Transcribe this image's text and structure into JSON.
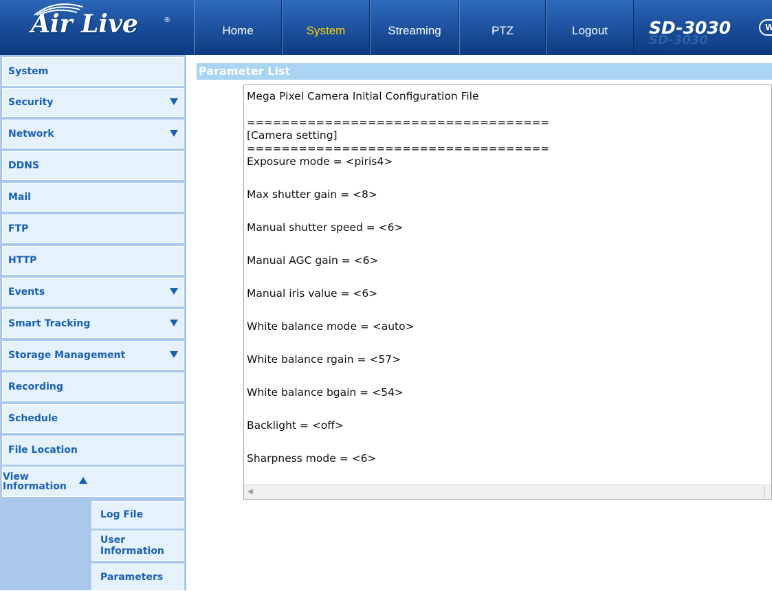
{
  "brand": {
    "logo_text": "Air Live",
    "reg_mark": "®",
    "model": "SD-3030",
    "model_badge": "W"
  },
  "nav": {
    "home": "Home",
    "system": "System",
    "streaming": "Streaming",
    "ptz": "PTZ",
    "logout": "Logout",
    "active": "System",
    "active_color": "#ffd400"
  },
  "sidebar": {
    "items": [
      {
        "label": "System",
        "expandable": false
      },
      {
        "label": "Security",
        "expandable": true
      },
      {
        "label": "Network",
        "expandable": true
      },
      {
        "label": "DDNS",
        "expandable": false
      },
      {
        "label": "Mail",
        "expandable": false
      },
      {
        "label": "FTP",
        "expandable": false
      },
      {
        "label": "HTTP",
        "expandable": false
      },
      {
        "label": "Events",
        "expandable": true
      },
      {
        "label": "Smart Tracking",
        "expandable": true
      },
      {
        "label": "Storage Management",
        "expandable": true
      },
      {
        "label": "Recording",
        "expandable": false
      },
      {
        "label": "Schedule",
        "expandable": false
      },
      {
        "label": "File Location",
        "expandable": false
      },
      {
        "label_line1": "View",
        "label_line2": "Information",
        "expanded": true
      }
    ],
    "sub_items": [
      {
        "label": "Log File"
      },
      {
        "label_line1": "User",
        "label_line2": "Information"
      },
      {
        "label": "Parameters"
      }
    ]
  },
  "main": {
    "section_title": "Parameter List",
    "lines": [
      "Mega Pixel Camera Initial Configuration File",
      "",
      "===================================",
      "[Camera setting]",
      "===================================",
      "Exposure mode = <piris4>",
      "",
      "Max shutter gain = <8>",
      "",
      "Manual shutter speed = <6>",
      "",
      "Manual AGC gain = <6>",
      "",
      "Manual iris value = <6>",
      "",
      "White balance mode = <auto>",
      "",
      "White balance rgain = <57>",
      "",
      "White balance bgain = <54>",
      "",
      "Backlight = <off>",
      "",
      "Sharpness mode = <6>"
    ]
  },
  "colors": {
    "header_blue": "#1a4f9c",
    "sidebar_bg": "#a9c8ec",
    "sidebar_item_bg": "#e6f2fb",
    "sidebar_text": "#1760b3",
    "section_header_bg": "#a9d4f2"
  }
}
